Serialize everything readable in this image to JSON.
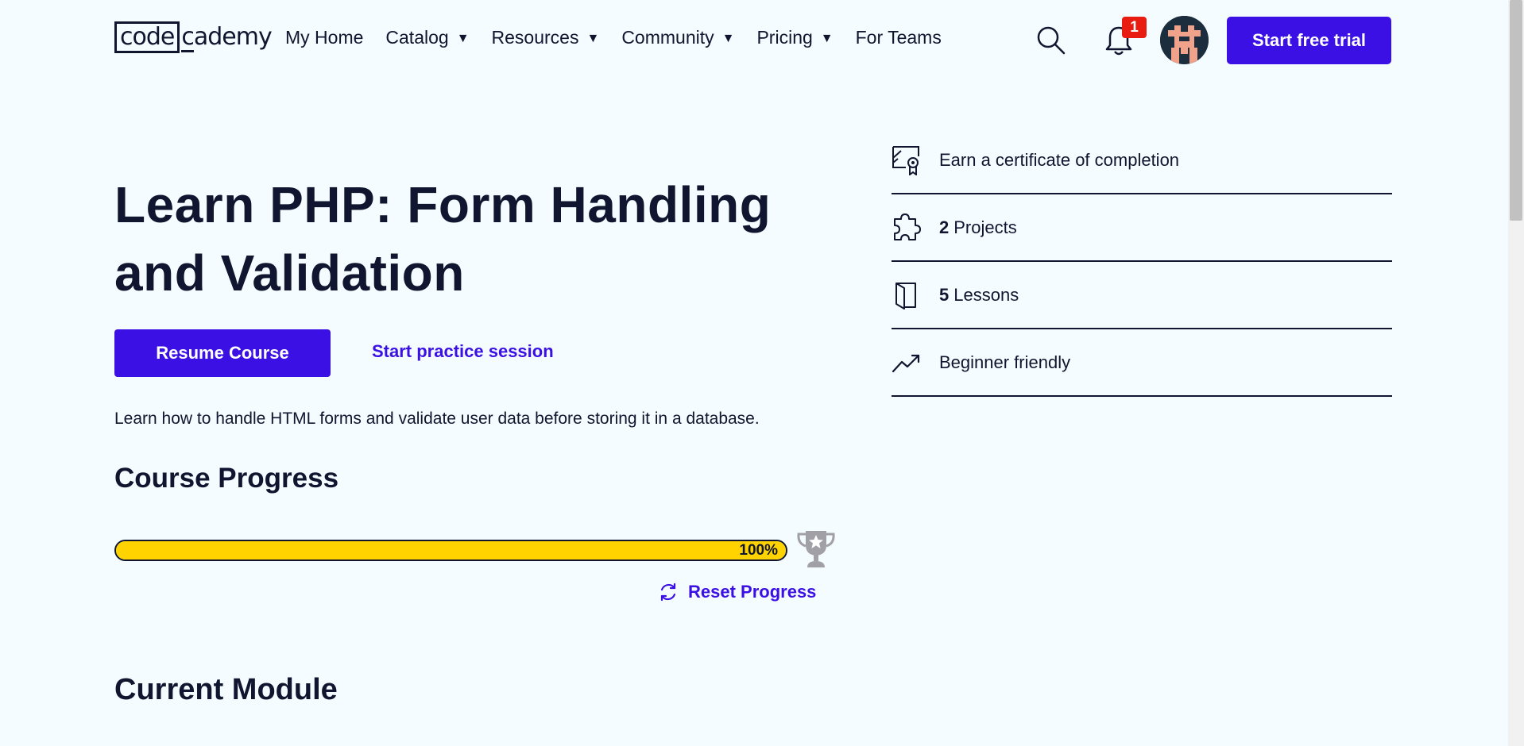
{
  "header": {
    "logo_code": "code",
    "logo_rest": "cademy",
    "nav": [
      {
        "label": "My Home",
        "dropdown": false
      },
      {
        "label": "Catalog",
        "dropdown": true
      },
      {
        "label": "Resources",
        "dropdown": true
      },
      {
        "label": "Community",
        "dropdown": true
      },
      {
        "label": "Pricing",
        "dropdown": true
      },
      {
        "label": "For Teams",
        "dropdown": false
      }
    ],
    "notification_count": "1",
    "trial_button": "Start free trial",
    "icons": {
      "search": "search-icon",
      "bell": "bell-icon",
      "caret": "▼"
    }
  },
  "hero": {
    "title": "Learn PHP: Form Handling and Validation",
    "resume_button": "Resume Course",
    "practice_link": "Start practice session",
    "description": "Learn how to handle HTML forms and validate user data before storing it in a database."
  },
  "progress": {
    "heading": "Course Progress",
    "percent": 100,
    "percent_label": "100%",
    "reset_label": "Reset Progress"
  },
  "features": [
    {
      "icon": "certificate-icon",
      "number": "",
      "label": "Earn a certificate of completion"
    },
    {
      "icon": "puzzle-icon",
      "number": "2",
      "label": "Projects"
    },
    {
      "icon": "book-icon",
      "number": "5",
      "label": "Lessons"
    },
    {
      "icon": "trend-up-icon",
      "number": "",
      "label": "Beginner friendly"
    }
  ],
  "module": {
    "heading": "Current Module"
  },
  "colors": {
    "accent": "#3a10e5",
    "progress": "#ffd300",
    "badge": "#e91c11",
    "background": "#f5fcff"
  }
}
